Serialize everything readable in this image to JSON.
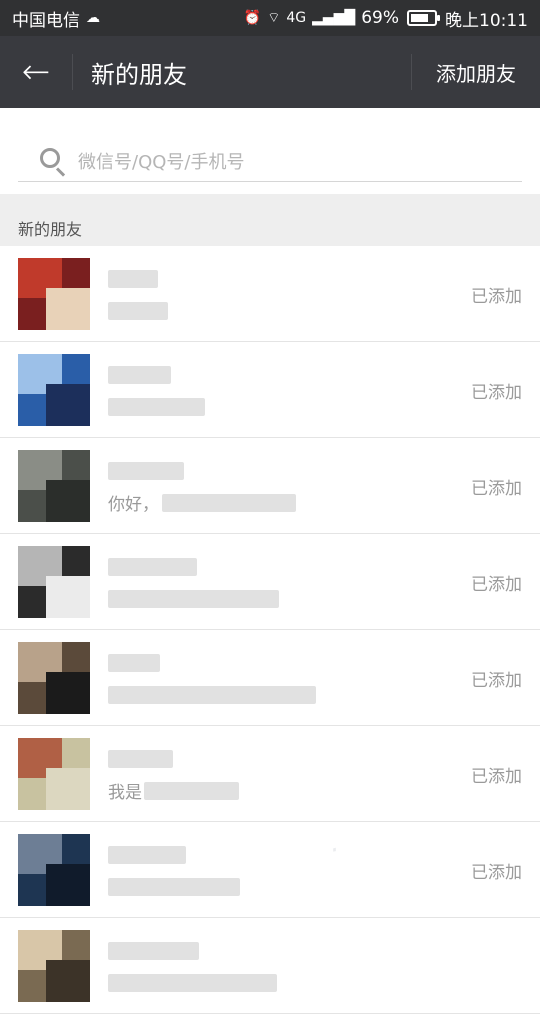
{
  "status_bar": {
    "carrier": "中国电信",
    "signal": "4G",
    "battery": "69%",
    "time": "晚上10:11"
  },
  "title_bar": {
    "back_icon": "arrow-left",
    "title": "新的朋友",
    "add_friend": "添加朋友"
  },
  "search": {
    "placeholder": "微信号/QQ号/手机号",
    "icon": "search-icon"
  },
  "section_header": "新的朋友",
  "friend_requests": [
    {
      "name": "",
      "message": "",
      "status": "已添加",
      "avatar_colors": [
        "#7a1f1f",
        "#c03a2b",
        "#e8d2b8"
      ]
    },
    {
      "name": "",
      "message": "",
      "status": "已添加",
      "avatar_colors": [
        "#2a5ea8",
        "#9cc0e8",
        "#1c2f5b"
      ]
    },
    {
      "name": "",
      "message": "你好，",
      "status": "已添加",
      "avatar_colors": [
        "#4b4f4a",
        "#8a8d86",
        "#2b2e2b"
      ]
    },
    {
      "name": "",
      "message": "",
      "status": "已添加",
      "avatar_colors": [
        "#2b2b2b",
        "#b5b5b5",
        "#ebebeb"
      ]
    },
    {
      "name": "",
      "message": "",
      "status": "已添加",
      "avatar_colors": [
        "#5b4a3a",
        "#b8a28a",
        "#1b1b1b"
      ]
    },
    {
      "name": "",
      "message": "我是",
      "status": "已添加",
      "avatar_colors": [
        "#c8c2a0",
        "#b06045",
        "#dcd7c0"
      ]
    },
    {
      "name": "",
      "message": "",
      "status": "已添加",
      "avatar_colors": [
        "#1e3552",
        "#6d7e95",
        "#101b2b"
      ]
    },
    {
      "name": "",
      "message": "",
      "status": "",
      "avatar_colors": [
        "#7a6a52",
        "#d8c6a8",
        "#3c3328"
      ]
    }
  ],
  "colors": {
    "status_bar_bg": "#303133",
    "title_bar_bg": "#393a3f",
    "section_bg": "#eeeeee",
    "status_text": "#9a9a9a"
  }
}
